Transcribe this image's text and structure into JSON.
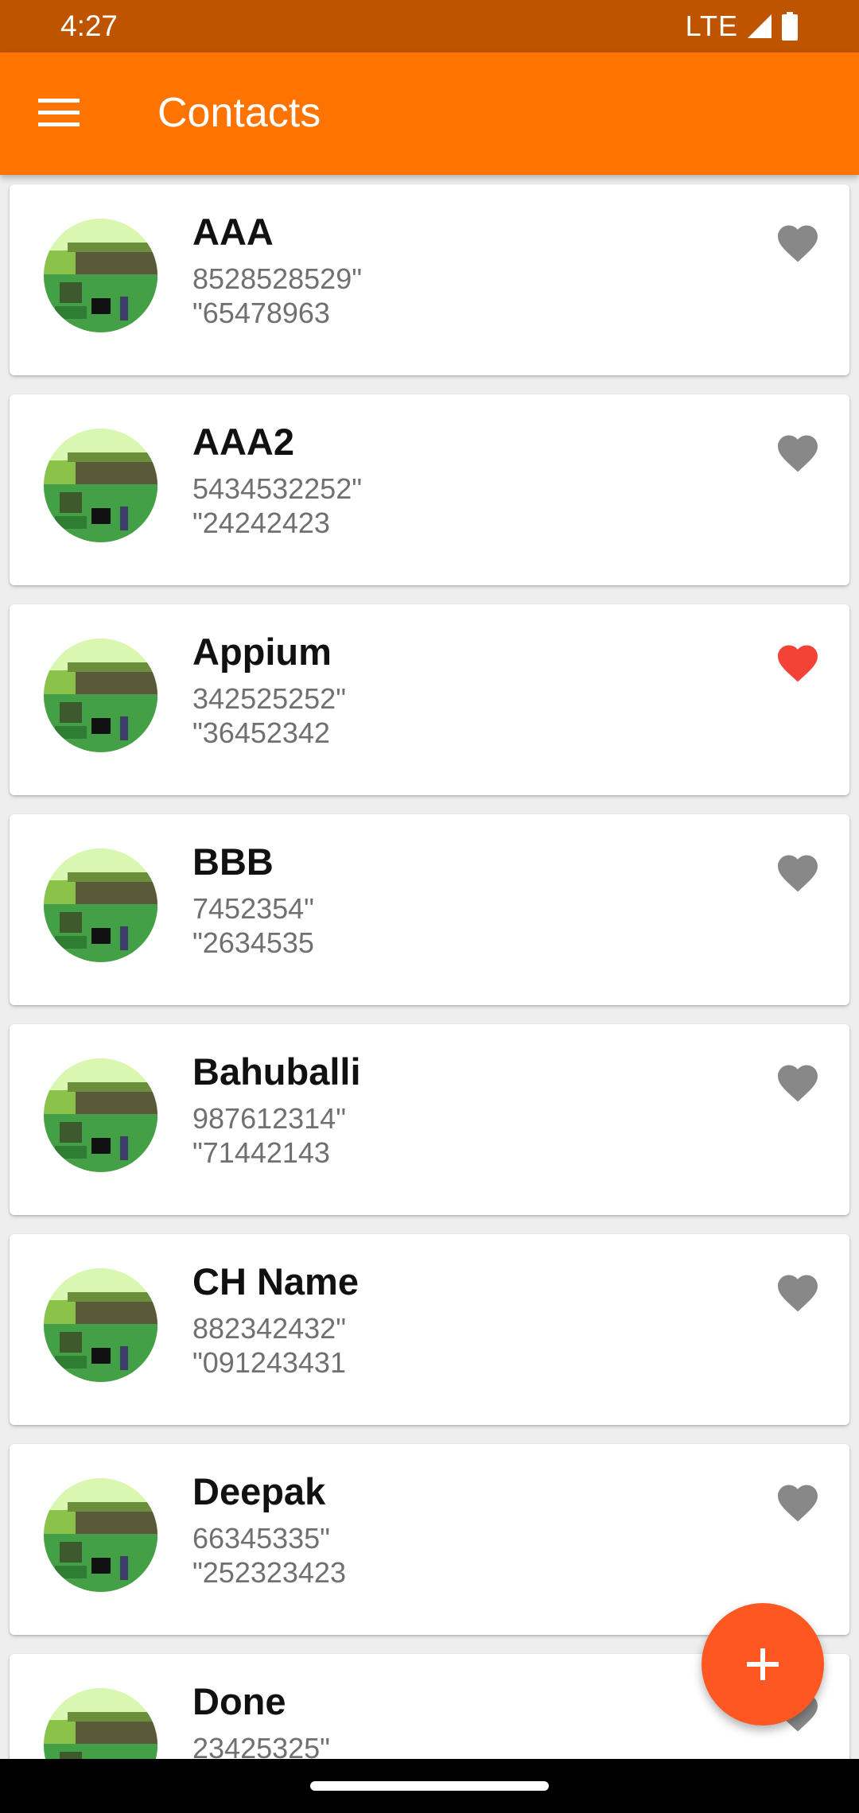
{
  "status_bar": {
    "time": "4:27",
    "network": "LTE"
  },
  "app_bar": {
    "title": "Contacts",
    "menu_icon": "hamburger-menu-icon"
  },
  "colors": {
    "app_bar": "#ff7300",
    "status_bar": "#bf5400",
    "favorite_active": "#f44336",
    "favorite_inactive": "#888888",
    "fab": "#ff5722"
  },
  "contacts": [
    {
      "name": "AAA",
      "phone_line1": "8528528529\"",
      "phone_line2": "\"65478963",
      "favorite": false
    },
    {
      "name": "AAA2",
      "phone_line1": "5434532252\"",
      "phone_line2": "\"24242423",
      "favorite": false
    },
    {
      "name": "Appium",
      "phone_line1": "342525252\"",
      "phone_line2": "\"36452342",
      "favorite": true
    },
    {
      "name": "BBB",
      "phone_line1": "7452354\"",
      "phone_line2": "\"2634535",
      "favorite": false
    },
    {
      "name": "Bahuballi",
      "phone_line1": "987612314\"",
      "phone_line2": "\"71442143",
      "favorite": false
    },
    {
      "name": "CH Name",
      "phone_line1": "882342432\"",
      "phone_line2": "\"091243431",
      "favorite": false
    },
    {
      "name": "Deepak",
      "phone_line1": "66345335\"",
      "phone_line2": "\"252323423",
      "favorite": false
    },
    {
      "name": "Done",
      "phone_line1": "23425325\"",
      "phone_line2": "",
      "favorite": false
    }
  ],
  "fab": {
    "icon": "plus-icon"
  }
}
